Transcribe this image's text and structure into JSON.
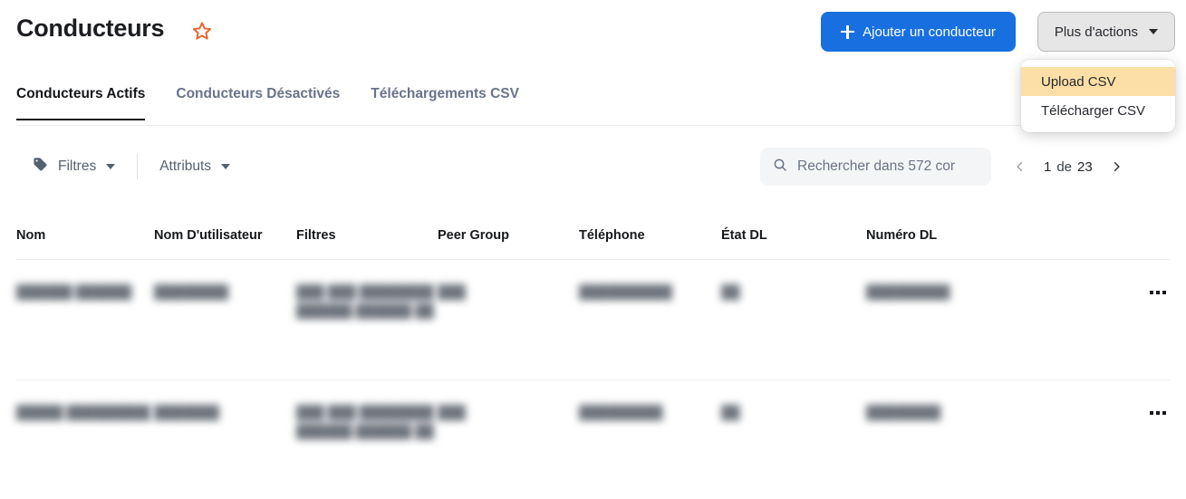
{
  "header": {
    "title": "Conducteurs",
    "favorite_icon": "star-outline-icon",
    "favorite_color": "#e8622c",
    "primary_button": {
      "label": "Ajouter un conducteur",
      "icon": "plus-icon",
      "color": "#1870e0"
    },
    "secondary_button": {
      "label": "Plus d'actions",
      "icon": "chevron-down-icon"
    }
  },
  "dropdown": {
    "open": true,
    "highlight_color": "#fcdfa6",
    "items": [
      {
        "label": "Upload CSV",
        "highlighted": true
      },
      {
        "label": "Télécharger CSV",
        "highlighted": false
      }
    ]
  },
  "tabs": [
    {
      "label": "Conducteurs Actifs",
      "active": true
    },
    {
      "label": "Conducteurs Désactivés",
      "active": false
    },
    {
      "label": "Téléchargements CSV",
      "active": false
    }
  ],
  "toolbar": {
    "filters": {
      "label": "Filtres",
      "icon": "tag-icon"
    },
    "attributes": {
      "label": "Attributs",
      "icon": "chevron-down-icon"
    }
  },
  "search": {
    "placeholder": "Rechercher dans 572 cor",
    "value": "",
    "icon": "search-icon"
  },
  "pagination": {
    "current_page": "1",
    "separator": "de",
    "total_pages": "23",
    "prev_icon": "chevron-left-icon",
    "next_icon": "chevron-right-icon",
    "prev_enabled": false,
    "next_enabled": true
  },
  "table": {
    "columns": [
      "Nom",
      "Nom D'utilisateur",
      "Filtres",
      "Peer Group",
      "Téléphone",
      "État DL",
      "Numéro DL",
      ""
    ],
    "rows": [
      {
        "nom": "██████ ██████",
        "nom_utilisateur": "████████",
        "filtres": "███ ███ ████████ ██████ ██████ ██",
        "peer_group": "███",
        "telephone": "██████████",
        "etat_dl": "██",
        "numero_dl": "█████████",
        "actions_icon": "ellipsis-icon"
      },
      {
        "nom": "█████ █████████",
        "nom_utilisateur": "███████",
        "filtres": "███ ███ ████████ ██████ ██████ ██",
        "peer_group": "███",
        "telephone": "█████████",
        "etat_dl": "██",
        "numero_dl": "████████",
        "actions_icon": "ellipsis-icon"
      }
    ]
  }
}
